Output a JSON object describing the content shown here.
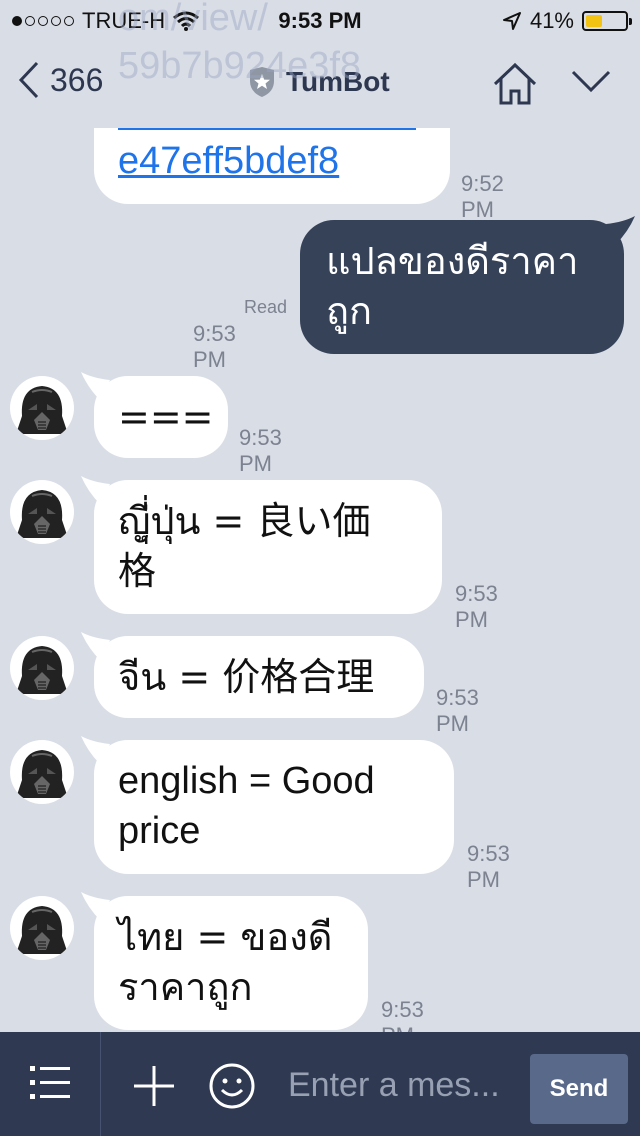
{
  "status_bar": {
    "carrier": "TRUE-H",
    "time": "9:53 PM",
    "battery": "41%",
    "battery_level": 0.41,
    "signal_bars": 1,
    "signal_total": 5,
    "icons": [
      "wifi-icon",
      "location-icon",
      "battery-icon"
    ]
  },
  "nav": {
    "back_count": "366",
    "title": "TumBot",
    "icons": [
      "back-chevron-icon",
      "shield-star-icon",
      "home-icon",
      "chevron-down-icon"
    ]
  },
  "messages": [
    {
      "side": "in",
      "link_text": "e47eff5bdef8",
      "faded_text": "om/view/\n59b7b924e3f8",
      "time": "9:52 PM"
    },
    {
      "side": "out",
      "text": "แปลของดีราคา\nถูก",
      "read": "Read",
      "time": "9:53 PM"
    },
    {
      "side": "in",
      "text": "===",
      "time": "9:53 PM"
    },
    {
      "side": "in",
      "text": "ญีุ่่ปุ่น = 良い価\n格",
      "time": "9:53 PM"
    },
    {
      "side": "in",
      "text": "จีน = 价格合理",
      "time": "9:53 PM"
    },
    {
      "side": "in",
      "text": "english = Good\nprice",
      "time": "9:53 PM"
    },
    {
      "side": "in",
      "text": "ไทย = ของดี\nราคาถูก",
      "time": "9:53 PM"
    }
  ],
  "composer": {
    "placeholder": "Enter a mes...",
    "send_label": "Send",
    "icons": [
      "menu-list-icon",
      "plus-icon",
      "smiley-icon"
    ]
  },
  "colors": {
    "background": "#d9dde6",
    "outgoing_bubble": "#364258",
    "incoming_bubble": "#ffffff",
    "link": "#1f74ea",
    "composer": "#2f3a52",
    "send_button": "#59698a",
    "battery_fill": "#f3c314"
  }
}
